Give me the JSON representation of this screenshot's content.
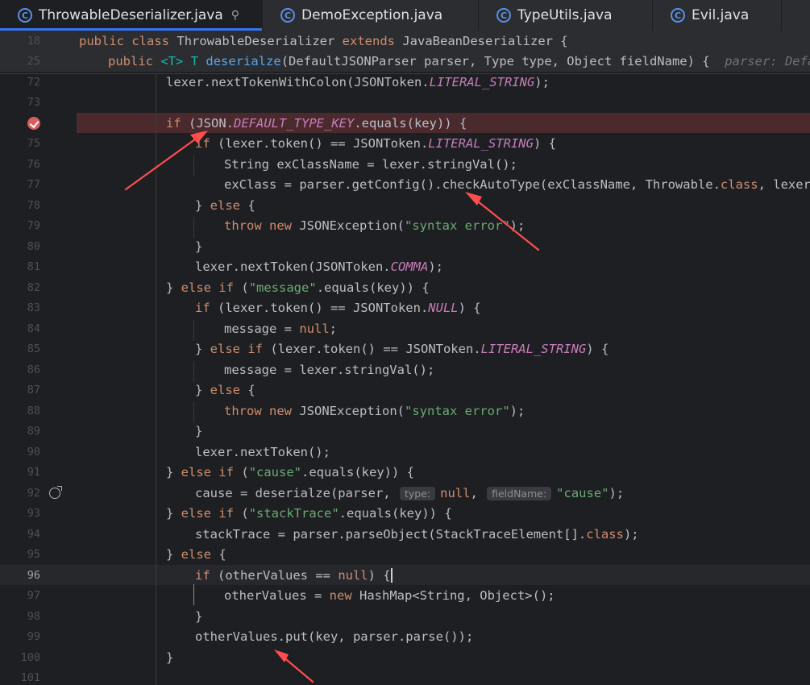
{
  "tabs": [
    {
      "label": "ThrowableDeserializer.java",
      "active": true,
      "pinned": true,
      "icon": "c-class-icon"
    },
    {
      "label": "DemoException.java",
      "active": false,
      "icon": "c-class-icon"
    },
    {
      "label": "TypeUtils.java",
      "active": false,
      "icon": "c-class-icon"
    },
    {
      "label": "Evil.java",
      "active": false,
      "icon": "c-class-icon"
    }
  ],
  "tab_icon_glyph": "C",
  "sticky": {
    "line1_num": "18",
    "line2_num": "25",
    "line1": {
      "kw1": "public",
      "kw2": "class",
      "name": "ThrowableDeserializer",
      "kw3": "extends",
      "base": "JavaBeanDeserializer {"
    },
    "line2": {
      "kw1": "public",
      "generic": "<T>",
      "t": "T",
      "method": "deserialze",
      "params": "(DefaultJSONParser parser, Type type, Object fieldName) {",
      "hint": "parser: Default"
    }
  },
  "lines": {
    "n72": "72",
    "n73": "73",
    "n75": "75",
    "n76": "76",
    "n77": "77",
    "n78": "78",
    "n79": "79",
    "n80": "80",
    "n81": "81",
    "n82": "82",
    "n83": "83",
    "n84": "84",
    "n85": "85",
    "n86": "86",
    "n87": "87",
    "n88": "88",
    "n89": "89",
    "n90": "90",
    "n91": "91",
    "n93": "93",
    "n94": "94",
    "n95": "95",
    "n96": "96",
    "n97": "97",
    "n98": "98",
    "n99": "99",
    "n100": "100",
    "n101": "101",
    "l72": {
      "a": "lexer.nextTokenWithColon(JSONToken.",
      "c": "LITERAL_STRING",
      "b": ");"
    },
    "l74": {
      "kw": "if",
      "a": " (JSON.",
      "c": "DEFAULT_TYPE_KEY",
      "b": ".equals(key)) {"
    },
    "l75": {
      "kw": "if",
      "a": " (lexer.token() == JSONToken.",
      "c": "LITERAL_STRING",
      "b": ") {"
    },
    "l76": "String exClassName = lexer.stringVal();",
    "l77": {
      "a": "exClass = parser.getConfig().checkAutoType(exClassName, Throwable.",
      "kw": "class",
      "b": ", lexer.ge"
    },
    "l78": {
      "a": "} ",
      "kw": "else",
      "b": " {"
    },
    "l79": {
      "kw1": "throw",
      "kw2": "new",
      "a": " JSONException(",
      "s": "\"syntax error\"",
      "b": ");"
    },
    "l80": "}",
    "l81": {
      "a": "lexer.nextToken(JSONToken.",
      "c": "COMMA",
      "b": ");"
    },
    "l82": {
      "a": "} ",
      "kw1": "else",
      "kw2": "if",
      "b": " (",
      "s": "\"message\"",
      "e": ".equals(key)) {"
    },
    "l83": {
      "kw": "if",
      "a": " (lexer.token() == JSONToken.",
      "c": "NULL",
      "b": ") {"
    },
    "l84": {
      "a": "message = ",
      "kw": "null",
      "b": ";"
    },
    "l85": {
      "a": "} ",
      "kw1": "else",
      "kw2": "if",
      "b": " (lexer.token() == JSONToken.",
      "c": "LITERAL_STRING",
      "e": ") {"
    },
    "l86": "message = lexer.stringVal();",
    "l87": {
      "a": "} ",
      "kw": "else",
      "b": " {"
    },
    "l88": {
      "kw1": "throw",
      "kw2": "new",
      "a": " JSONException(",
      "s": "\"syntax error\"",
      "b": ");"
    },
    "l89": "}",
    "l90": "lexer.nextToken();",
    "l91": {
      "a": "} ",
      "kw1": "else",
      "kw2": "if",
      "b": " (",
      "s": "\"cause\"",
      "e": ".equals(key)) {"
    },
    "l92": {
      "a": "cause = deserialze(parser, ",
      "h1": "type:",
      "kw": "null",
      "b": ", ",
      "h2": "fieldName:",
      "s": "\"cause\"",
      "e": ");"
    },
    "l93": {
      "a": "} ",
      "kw1": "else",
      "kw2": "if",
      "b": " (",
      "s": "\"stackTrace\"",
      "e": ".equals(key)) {"
    },
    "l94": {
      "a": "stackTrace = parser.parseObject(StackTraceElement[].",
      "kw": "class",
      "b": ");"
    },
    "l95": {
      "a": "} ",
      "kw": "else",
      "b": " {"
    },
    "l96": {
      "kw1": "if",
      "a": " (otherValues == ",
      "kw2": "null",
      "b": ") {"
    },
    "l97": {
      "a": "otherValues = ",
      "kw": "new",
      "b": " HashMap<String, Object>();"
    },
    "l98": "}",
    "l99": "otherValues.put(key, parser.parse());",
    "l100": "}"
  },
  "colors": {
    "arrow": "#ff4d4f",
    "breakpoint": "#db5c5c",
    "accent": "#3574f0"
  }
}
